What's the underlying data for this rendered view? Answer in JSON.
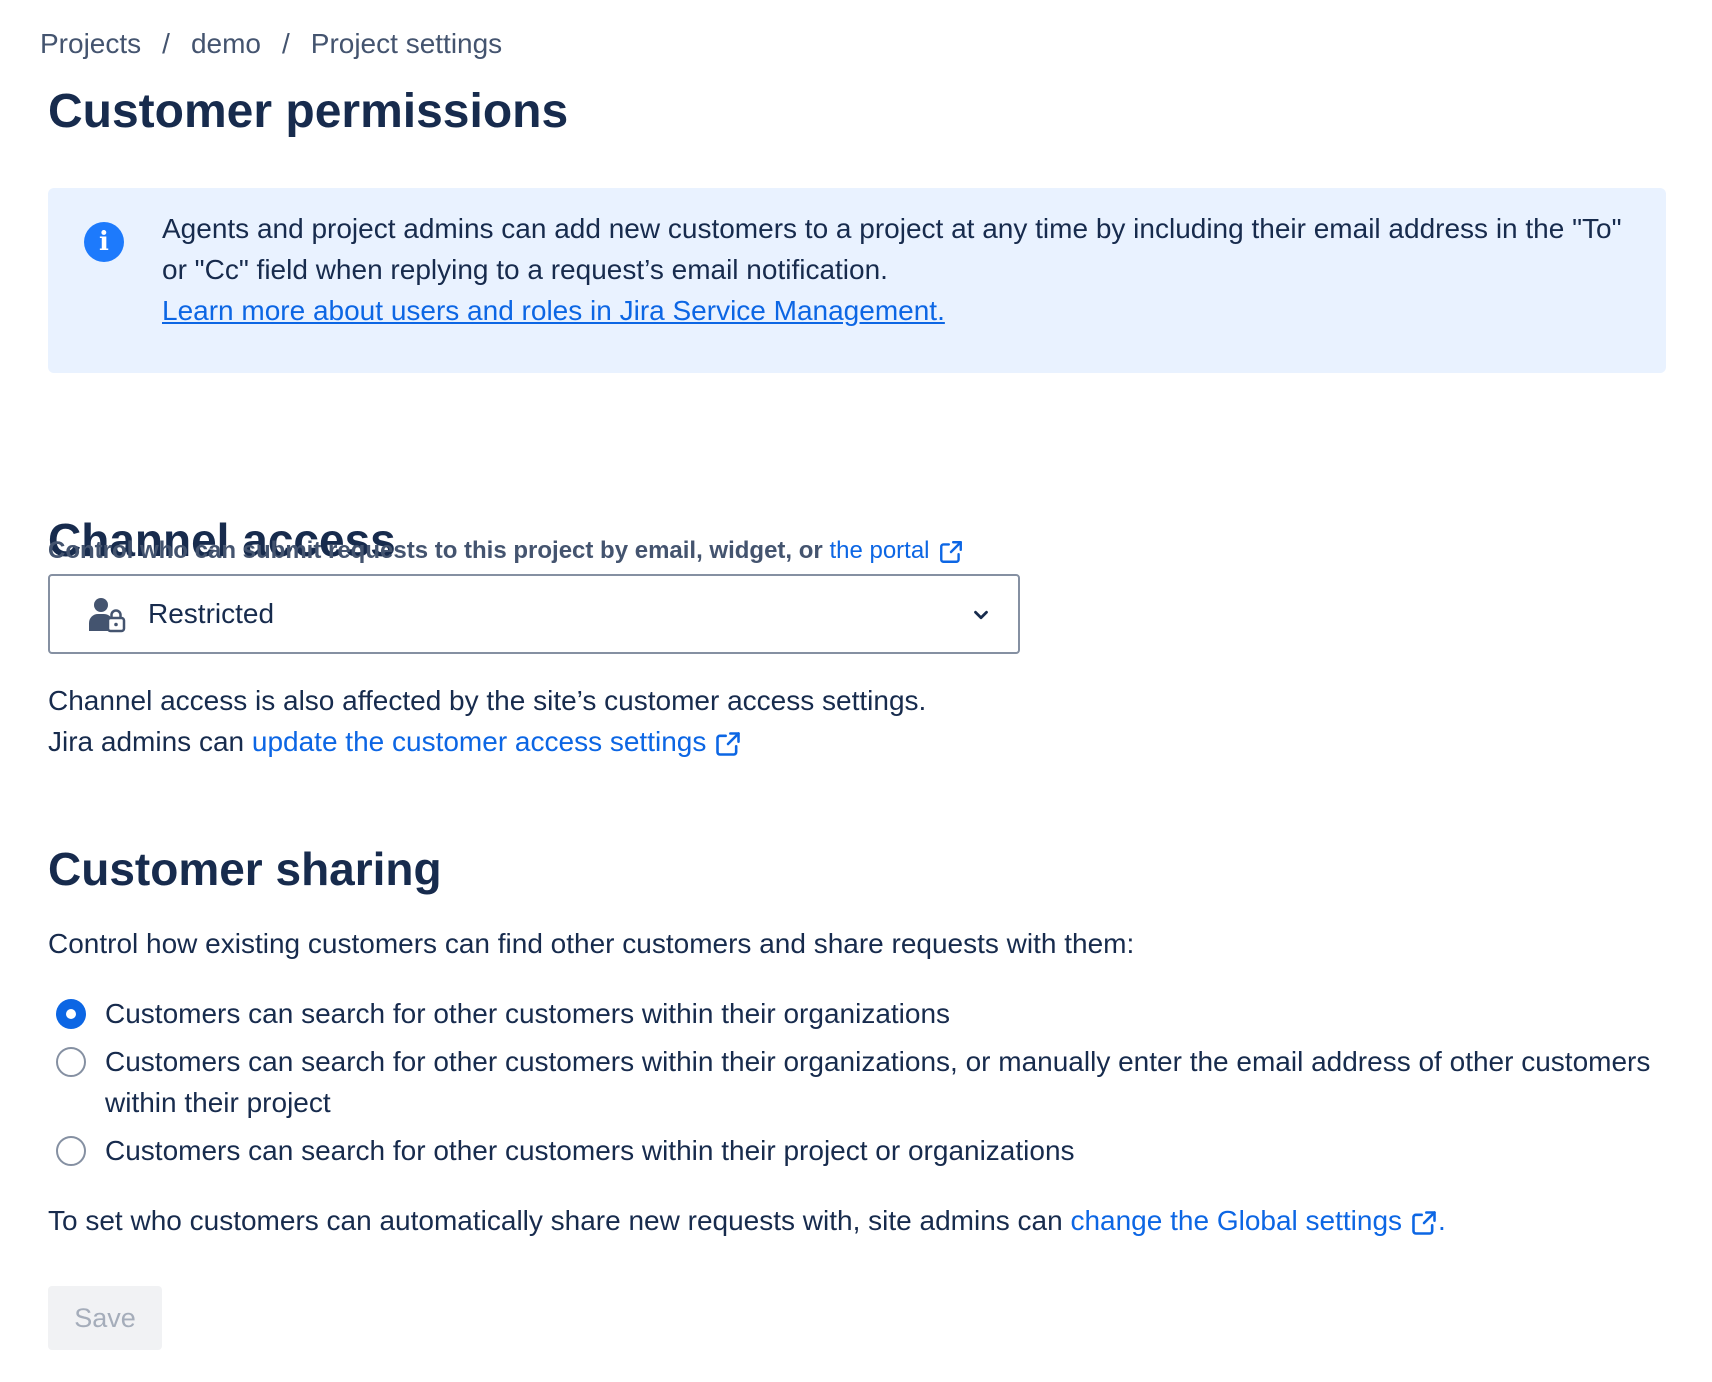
{
  "breadcrumb": {
    "items": [
      "Projects",
      "demo",
      "Project settings"
    ],
    "separator": "/"
  },
  "page_title": "Customer permissions",
  "info_banner": {
    "icon": "info-icon",
    "text": "Agents and project admins can add new customers to a project at any time by including their email address in the \"To\" or \"Cc\" field when replying to a request’s email notification.",
    "link_text": "Learn more about users and roles in Jira Service Management."
  },
  "channel_access": {
    "title": "Channel access",
    "label_prefix": "Control who can submit requests to this project by email, widget, or",
    "label_link": "the portal",
    "select": {
      "icon": "user-lock-icon",
      "value": "Restricted"
    },
    "help_line1": "Channel access is also affected by the site’s customer access settings.",
    "help_line2_prefix": "Jira admins can",
    "help_line2_link": "update the customer access settings"
  },
  "customer_sharing": {
    "title": "Customer sharing",
    "intro": "Control how existing customers can find other customers and share requests with them:",
    "options": [
      {
        "label": "Customers can search for other customers within their organizations",
        "checked": true
      },
      {
        "label": "Customers can search for other customers within their organizations, or manually enter the email address of other customers within their project",
        "checked": false
      },
      {
        "label": "Customers can search for other customers within their project or organizations",
        "checked": false
      }
    ],
    "global_prefix": "To set who customers can automatically share new requests with, site admins can",
    "global_link": "change the Global settings",
    "global_suffix": "."
  },
  "save_button": {
    "label": "Save",
    "disabled": true
  },
  "colors": {
    "text": "#172b4d",
    "subtle_text": "#44546f",
    "link": "#0c66e4",
    "info_bg": "#e9f2ff",
    "info_icon": "#1d7afc",
    "radio_checked": "#0c66e4"
  }
}
